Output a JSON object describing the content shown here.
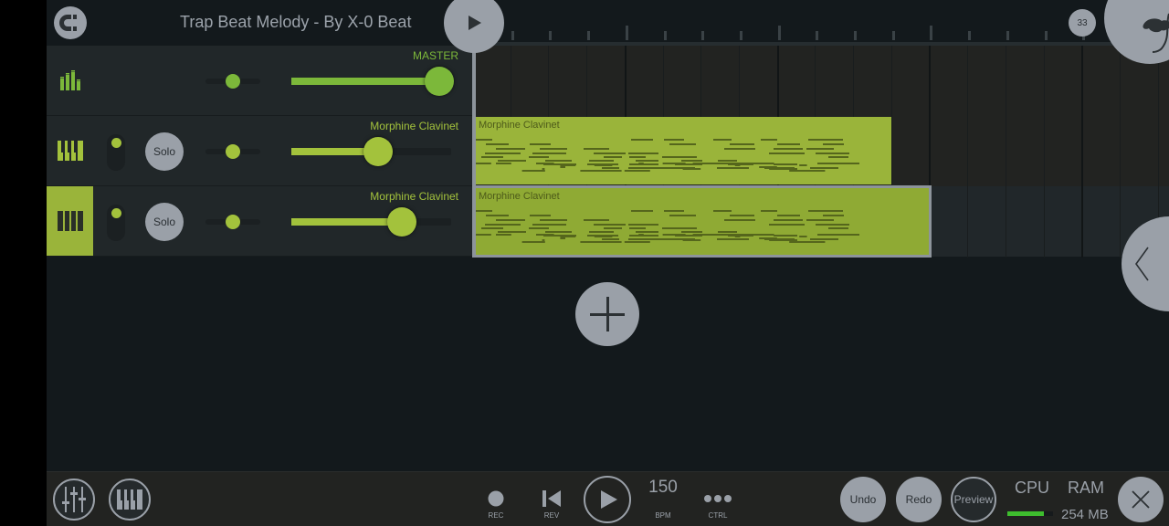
{
  "header": {
    "title": "Trap Beat Melody - By X-0 Beat",
    "snap_icon": "magnet-icon",
    "play_icon": "play-icon",
    "bar_number": "33",
    "fl_logo_icon": "fruit-logo-icon"
  },
  "channels": [
    {
      "name": "MASTER",
      "icon": "mixer-levels-icon",
      "type": "master",
      "pan": 0.5,
      "volume": 1.0,
      "selected": false
    },
    {
      "name": "Morphine Clavinet",
      "icon": "piano-keys-icon",
      "type": "instrument",
      "solo_label": "Solo",
      "muted": false,
      "pan": 0.5,
      "volume": 0.57,
      "selected": false
    },
    {
      "name": "Morphine Clavinet",
      "icon": "piano-keys-icon",
      "type": "instrument",
      "solo_label": "Solo",
      "muted": false,
      "pan": 0.5,
      "volume": 0.74,
      "selected": true
    }
  ],
  "playlist": {
    "clips": [
      {
        "lane": 1,
        "label": "Morphine Clavinet",
        "start_bar": 1,
        "length_bars": 11,
        "selected": false
      },
      {
        "lane": 2,
        "label": "Morphine Clavinet",
        "start_bar": 1,
        "length_bars": 12,
        "selected": true
      }
    ],
    "add_track_icon": "plus-icon",
    "side_panel_icon": "chevron-left-icon"
  },
  "bottombar": {
    "mixer_icon": "mixer-faders-icon",
    "piano_icon": "piano-keys-icon",
    "rec_label": "REC",
    "rev_label": "REV",
    "bpm_value": "150",
    "bpm_label": "BPM",
    "ctrl_label": "CTRL",
    "undo_label": "Undo",
    "redo_label": "Redo",
    "preview_label": "Preview",
    "cpu_label": "CPU",
    "cpu_usage": 0.8,
    "ram_label": "RAM",
    "ram_value": "254 MB",
    "close_icon": "close-icon"
  },
  "colors": {
    "accent": "#9ab43a",
    "master_accent": "#7cb83a",
    "button_gray": "#9aa0a8",
    "background": "#13191c",
    "cpu_green": "#3ebd2e"
  }
}
